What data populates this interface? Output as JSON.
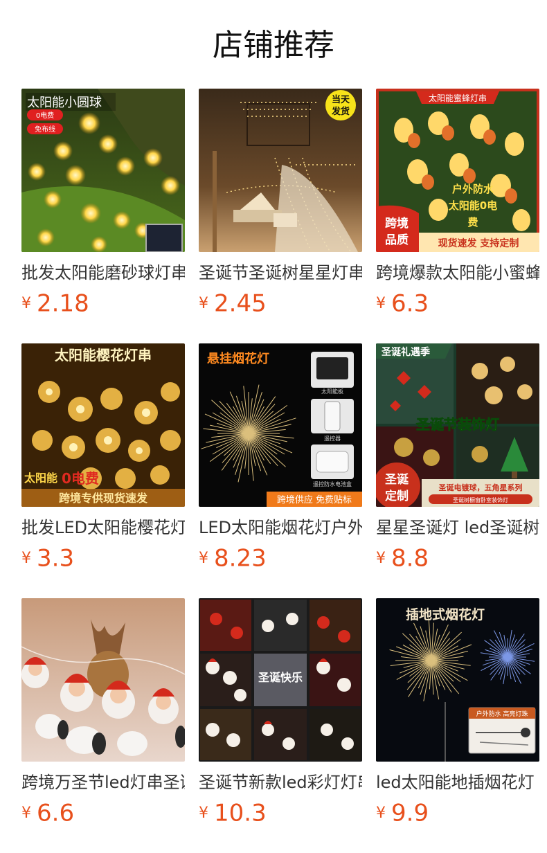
{
  "header": {
    "title": "店铺推荐"
  },
  "products": [
    {
      "name": "批发太阳能磨砂球灯串",
      "currency": "¥",
      "price": "2.18",
      "badges": [
        "太阳能小圆球",
        "0电费",
        "免布线"
      ]
    },
    {
      "name": "圣诞节圣诞树星星灯串",
      "currency": "¥",
      "price": "2.45",
      "badges": [
        "当天",
        "发货"
      ]
    },
    {
      "name": "跨境爆款太阳能小蜜蜂灯串",
      "currency": "¥",
      "price": "6.3",
      "badges": [
        "太阳能蜜蜂灯串",
        "户外防水",
        "太阳能0电",
        "费",
        "跨境",
        "品质",
        "现货速发 支持定制"
      ]
    },
    {
      "name": "批发LED太阳能樱花灯串",
      "currency": "¥",
      "price": "3.3",
      "badges": [
        "太阳能樱花灯串",
        "太阳能",
        "0电费",
        "跨境专供现货速发"
      ]
    },
    {
      "name": "LED太阳能烟花灯户外",
      "currency": "¥",
      "price": "8.23",
      "badges": [
        "悬挂烟花灯",
        "太阳能板",
        "遥控器",
        "遥控防水电池盒",
        "跨境供应 免费贴标"
      ]
    },
    {
      "name": "星星圣诞灯 led圣诞树装饰",
      "currency": "¥",
      "price": "8.8",
      "badges": [
        "圣诞礼遇季",
        "圣诞节装饰灯",
        "圣诞",
        "定制",
        "圣诞电镀球，五角星系列",
        "圣诞树橱窗卧室装饰灯"
      ]
    },
    {
      "name": "跨境万圣节led灯串圣诞老人",
      "currency": "¥",
      "price": "6.6",
      "badges": []
    },
    {
      "name": "圣诞节新款led彩灯灯串",
      "currency": "¥",
      "price": "10.3",
      "badges": [
        "圣诞快乐"
      ]
    },
    {
      "name": "led太阳能地插烟花灯",
      "currency": "¥",
      "price": "9.9",
      "badges": [
        "插地式烟花灯",
        "户外防水 高亮灯珠"
      ]
    }
  ]
}
